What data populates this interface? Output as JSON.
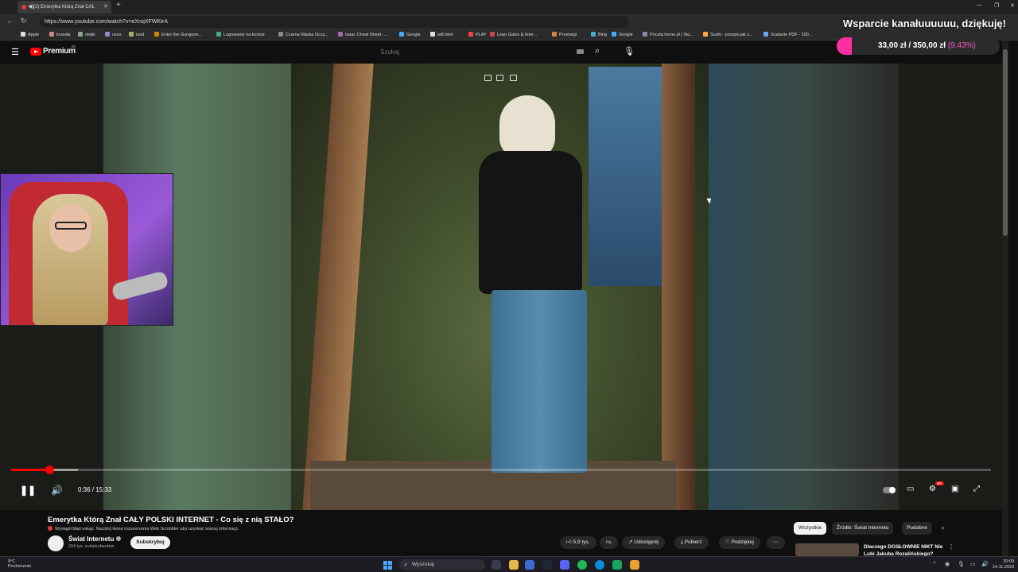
{
  "browser": {
    "tab_title": "(2) Emerytka Którą Znał CAŁ",
    "url": "https://www.youtube.com/watch?v=eXnqXFWKtrA",
    "bookmarks": [
      "Apple",
      "krzesła",
      "olejki",
      "usos",
      "isod",
      "Enter the Gungeon...",
      "Logowanie na koncie",
      "Czarna Maska Oczy...",
      "Isaac Cheat Sheet -...",
      "Google",
      "will.html",
      "PLAY",
      "Lean Gains & Inter...",
      "Przetargi",
      "Bing",
      "Google",
      "Poczta home.pl | Skr...",
      "Sushi - przepis jak z...",
      "Scalanie PDF - 100..."
    ]
  },
  "youtube": {
    "brand": "Premium",
    "region": "PL",
    "search_placeholder": "Szukaj"
  },
  "donation": {
    "title": "Wsparcie kanałuuuuuu, dziękuję!",
    "amount": "33,00 zł / 350,00 zł",
    "percent_label": "(9.43%)",
    "fraction": 0.0943,
    "color": "#ff2fa0"
  },
  "player": {
    "time": "0:36 / 15:33",
    "played_fraction": 0.039,
    "buffered_fraction": 0.068,
    "hd_badge": "HD",
    "progress_color": "#ff0000"
  },
  "video_info": {
    "title": "Emerytka Którą Znał CAŁY POLSKI INTERNET - Co się z nią STAŁO?",
    "scrobbler_notice": "Wystąpił błąd usługi. Naciśnij ikonę rozszerzenia Web Scrobbler aby uzyskać więcej informacji.",
    "channel_name": "Świat Internetu",
    "subscribers": "204 tys. subskrybentów",
    "subscribe_label": "Subskrybuj",
    "likes": "5,9 tys.",
    "share_label": "Udostępnij",
    "download_label": "Pobierz",
    "thanks_label": "Podziękuj"
  },
  "chips": {
    "all": "Wszystkie",
    "source": "Źródło: Świat Internetu",
    "similar": "Podobne"
  },
  "recommendation": {
    "title": "Dlaczego DOSŁOWNIE NIKT Nie Lubi Jakuba Rozalińskiego?"
  },
  "taskbar": {
    "temperature": "9°C",
    "weather": "Pochmurnie",
    "search_label": "Wyszukaj",
    "time": "20:09",
    "date": "14.11.2023"
  }
}
